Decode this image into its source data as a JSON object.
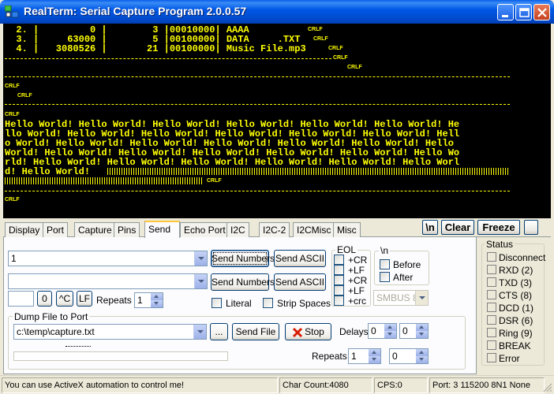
{
  "window": {
    "title": "RealTerm: Serial Capture Program 2.0.0.57"
  },
  "terminal": {
    "lines": [
      "  2. |         0 |        3 |00010000| AAAA",
      "  3. |     63000 |        5 |00100000| DATA     .TXT",
      "  4. |   3080526 |       21 |00100000| Music File.mp3"
    ],
    "hello": [
      "Hello World! Hello World! Hello World! Hello World! Hello World! Hello World! He",
      "llo World! Hello World! Hello World! Hello World! Hello World! Hello World! Hell",
      "o World! Hello World! Hello World! Hello World! Hello World! Hello World! Hello ",
      "World! Hello World! Hello World! Hello World! Hello World! Hello World! Hello Wo",
      "rld! Hello World! Hello World! Hello World! Hello World! Hello World! Hello Worl",
      "d! Hello World! "
    ],
    "crlf": "CRLF"
  },
  "tabs": [
    "Display",
    "Port",
    "Capture",
    "Pins",
    "Send",
    "Echo Port",
    "I2C",
    "I2C-2",
    "I2CMisc",
    "Misc"
  ],
  "active_tab": "Send",
  "toolbar": {
    "newline": "\\n",
    "clear": "Clear",
    "freeze": "Freeze"
  },
  "send": {
    "input1": "1",
    "input2": "",
    "send_numbers": "Send Numbers",
    "send_ascii": "Send ASCII",
    "zero": "0",
    "ctrl_c": "^C",
    "lf": "LF",
    "repeats_label": "Repeats",
    "repeats_value": "1",
    "literal": "Literal",
    "strip_spaces": "Strip Spaces",
    "eol_title": "EOL",
    "eol_opts": [
      "+CR",
      "+LF",
      "+CR",
      "+LF",
      "+crc"
    ],
    "nl_title": "\\n",
    "before": "Before",
    "after": "After",
    "smbus": "SMBUS 8"
  },
  "dump": {
    "title": "Dump File to Port",
    "file": "c:\\temp\\capture.txt",
    "browse": "...",
    "send_file": "Send File",
    "stop": "Stop",
    "delays_label": "Delays",
    "delay1": "0",
    "delay2": "0",
    "repeats_label": "Repeats",
    "repeats1": "1",
    "repeats2": "0",
    "progress": 0
  },
  "status": {
    "title": "Status",
    "items": [
      "Disconnect",
      "RXD (2)",
      "TXD (3)",
      "CTS (8)",
      "DCD (1)",
      "DSR (6)",
      "Ring (9)",
      "BREAK",
      "Error"
    ]
  },
  "statusbar": {
    "message": "You can use ActiveX automation to control me!",
    "char_count": "Char Count:4080",
    "cps": "CPS:0",
    "port": "Port: 3 115200 8N1 None"
  }
}
